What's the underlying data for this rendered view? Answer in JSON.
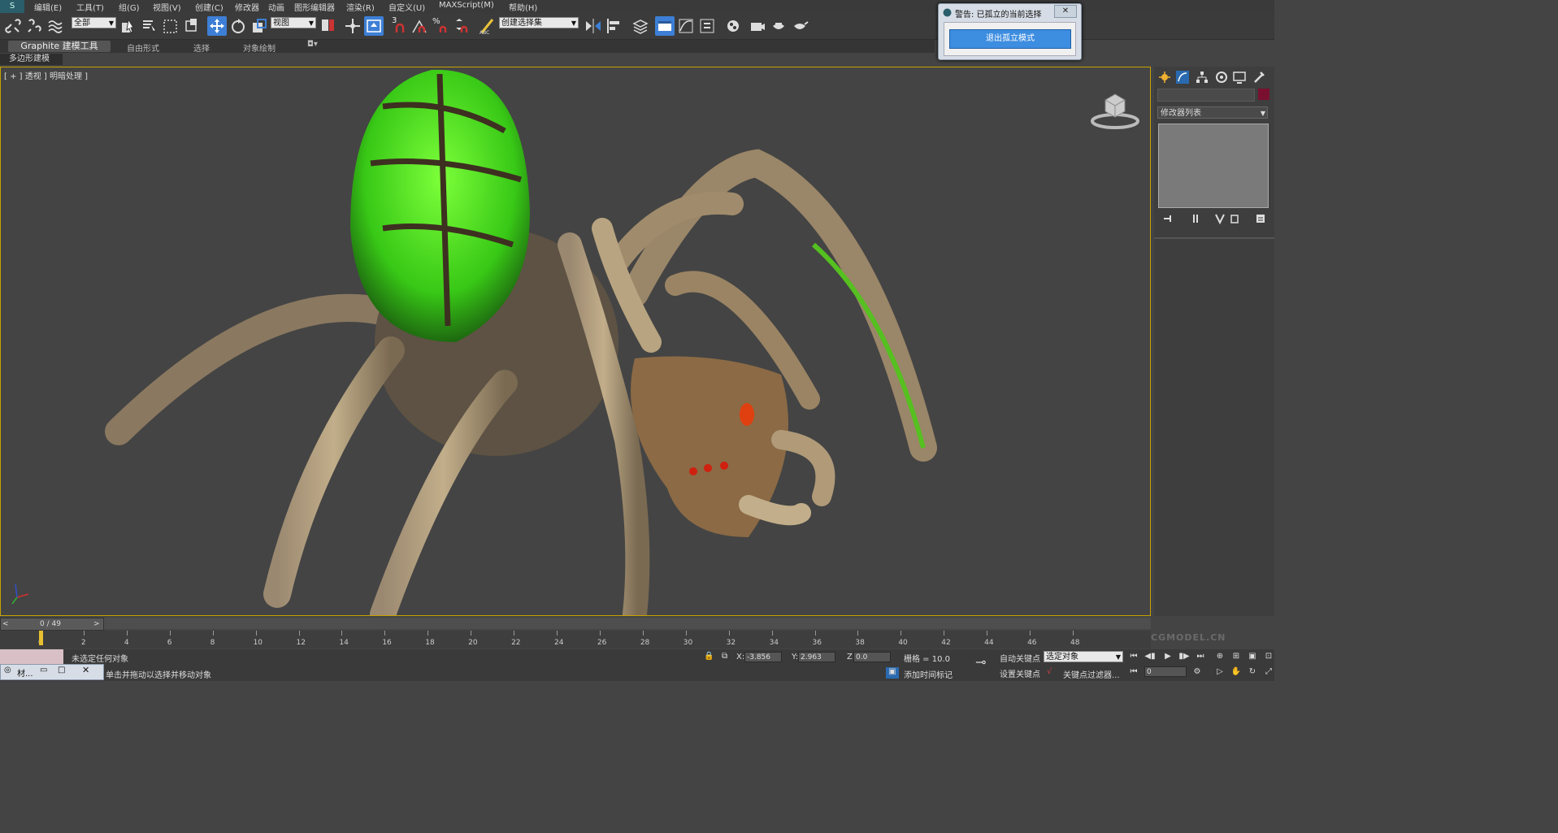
{
  "app": {
    "logo": "S"
  },
  "menu": [
    "编辑(E)",
    "工具(T)",
    "组(G)",
    "视图(V)",
    "创建(C)",
    "修改器",
    "动画",
    "图形编辑器",
    "渲染(R)",
    "自定义(U)",
    "MAXScript(M)",
    "帮助(H)"
  ],
  "toolbar": {
    "selection_filter": "全部",
    "ref_coord": "视图",
    "named_selection": "创建选择集",
    "snap_3": "3",
    "snap_percent": "%"
  },
  "ribbon": {
    "tabs": [
      "Graphite 建模工具",
      "自由形式",
      "选择",
      "对象绘制"
    ],
    "subtab": "多边形建模"
  },
  "viewport": {
    "label": "[ + ] 透视 ] 明暗处理 ]"
  },
  "dialog": {
    "title": "警告: 已孤立的当前选择",
    "close": "✕",
    "button": "退出孤立模式"
  },
  "command_panel": {
    "modifier_list": "修改器列表"
  },
  "timeline": {
    "frame_display": "0 / 49",
    "ticks": [
      "0",
      "2",
      "4",
      "6",
      "8",
      "10",
      "12",
      "14",
      "16",
      "18",
      "20",
      "22",
      "24",
      "26",
      "28",
      "30",
      "32",
      "34",
      "36",
      "38",
      "40",
      "42",
      "44",
      "46",
      "48"
    ],
    "watermark": "CGMODEL.CN"
  },
  "status": {
    "script_tab": "材...",
    "selection_text": "未选定任何对象",
    "prompt_text": "单击并拖动以选择并移动对象",
    "x_label": "X:",
    "x_value": "-3.856",
    "y_label": "Y:",
    "y_value": "2.963",
    "z_label": "Z:",
    "z_value": "0.0",
    "grid": "栅格 = 10.0",
    "add_time_tag": "添加时间标记",
    "auto_key": "自动关键点",
    "set_key": "设置关键点",
    "key_mode": "选定对象",
    "key_filter": "关键点过滤器...",
    "current_frame": "0"
  },
  "colors": {
    "accent": "#3d7fd6",
    "viewport_border": "#c8a200",
    "creature_glow": "#44dd22"
  }
}
